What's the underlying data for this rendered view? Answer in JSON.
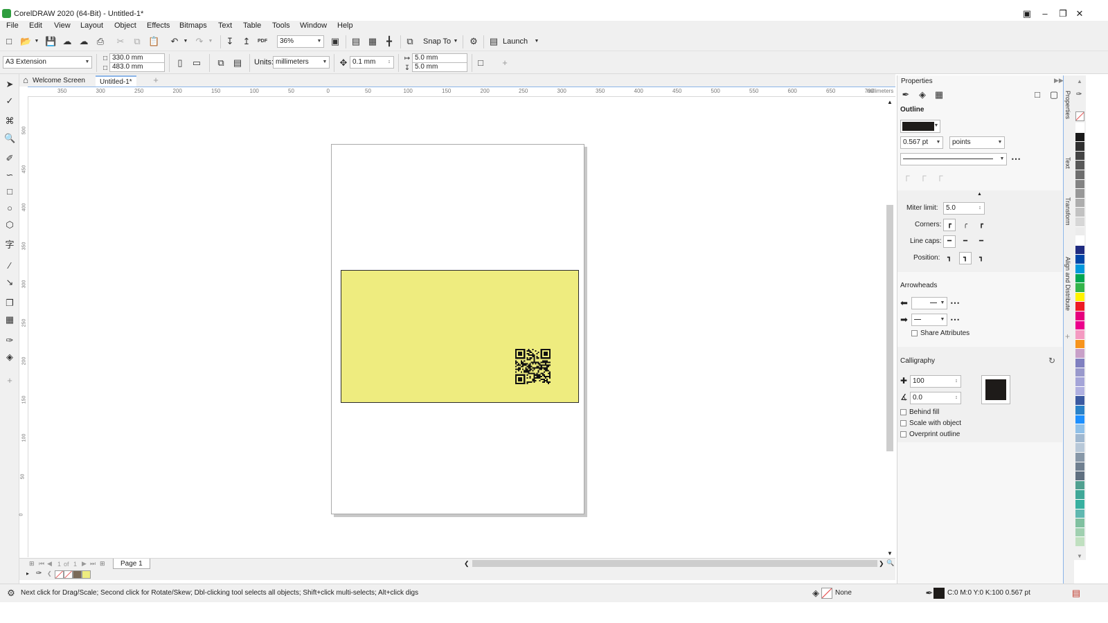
{
  "window": {
    "title": "CorelDRAW 2020 (64-Bit) - Untitled-1*"
  },
  "menu": [
    "File",
    "Edit",
    "View",
    "Layout",
    "Object",
    "Effects",
    "Bitmaps",
    "Text",
    "Table",
    "Tools",
    "Window",
    "Help"
  ],
  "toolbar": {
    "zoom": "36%",
    "snap_label": "Snap To",
    "launch_label": "Launch",
    "pdf_label": "PDF"
  },
  "propbar": {
    "page_size": "A3 Extension",
    "width": "330.0 mm",
    "height": "483.0 mm",
    "units_label": "Units:",
    "units": "millimeters",
    "nudge": "0.1 mm",
    "dup_x": "5.0 mm",
    "dup_y": "5.0 mm"
  },
  "doc_tabs": {
    "welcome": "Welcome Screen",
    "doc": "Untitled-1*"
  },
  "ruler": {
    "h_ticks": [
      "350",
      "300",
      "250",
      "200",
      "150",
      "100",
      "50",
      "0",
      "50",
      "100",
      "150",
      "200",
      "250",
      "300",
      "350",
      "400",
      "450",
      "500",
      "550",
      "600",
      "650",
      "700"
    ],
    "h_unit": "millimeters",
    "v_ticks": [
      "500",
      "450",
      "400",
      "350",
      "300",
      "250",
      "200",
      "150",
      "100",
      "50",
      "0"
    ]
  },
  "page_nav": {
    "current": "1",
    "of_label": "of",
    "total": "1",
    "page_tab": "Page 1"
  },
  "status": {
    "hint": "Next click for Drag/Scale; Second click for Rotate/Skew; Dbl-clicking tool selects all objects; Shift+click multi-selects; Alt+click digs",
    "fill": "None",
    "outline": "C:0 M:0 Y:0 K:100  0.567 pt"
  },
  "properties": {
    "title": "Properties",
    "outline_header": "Outline",
    "width_value": "0.567 pt",
    "width_units": "points",
    "miter_label": "Miter limit:",
    "miter_value": "5.0",
    "corners_label": "Corners:",
    "linecaps_label": "Line caps:",
    "position_label": "Position:",
    "arrowheads_label": "Arrowheads",
    "share_label": "Share Attributes",
    "calligraphy_label": "Calligraphy",
    "stretch_value": "100",
    "angle_value": "0.0",
    "behind_fill": "Behind fill",
    "scale_with_object": "Scale with object",
    "overprint": "Overprint outline"
  },
  "docker_tabs": [
    "Properties",
    "Text",
    "Transform",
    "Align and Distribute"
  ],
  "colors": {
    "page_rect": "#eeec7f",
    "accent": "#8ab4e8",
    "outline_swatch": "#1e1b19"
  },
  "palette": [
    "#ffffff",
    "#1a1a1a",
    "#2f2f2f",
    "#444444",
    "#595959",
    "#6e6e6e",
    "#838383",
    "#989898",
    "#adadad",
    "#c2c2c2",
    "#d7d7d7",
    "#ececec",
    "#ffffff",
    "#1f2b80",
    "#0046a8",
    "#0098dc",
    "#00a651",
    "#34b44a",
    "#fff200",
    "#ed1c24",
    "#e6007e",
    "#ec008c",
    "#f49ac1",
    "#f7941d",
    "#c8a0c8",
    "#8080c0",
    "#9999cc",
    "#a5a5d8",
    "#b0b0e0",
    "#3c5aa0",
    "#2a82c8",
    "#1e90ff",
    "#90c0e8",
    "#a0b8d0",
    "#b8c8d8",
    "#8898a8",
    "#708090",
    "#607080",
    "#50a090",
    "#40a898",
    "#38b0a0",
    "#60b8b0",
    "#80c0a0",
    "#a0d0b0",
    "#c0e0c0"
  ]
}
